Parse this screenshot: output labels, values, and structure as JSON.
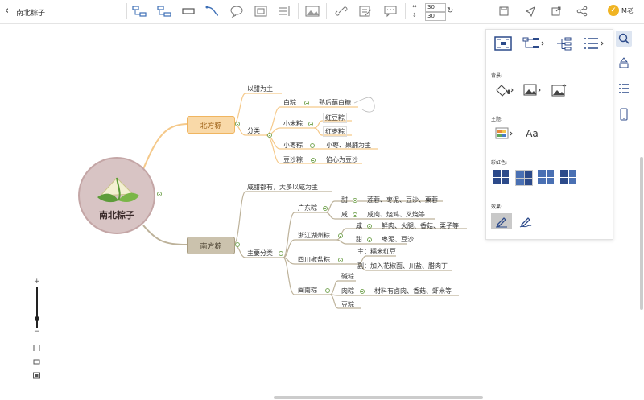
{
  "header": {
    "back_glyph": "‹",
    "title": "南北粽子",
    "width_value": "30",
    "height_value": "30",
    "user_name": "M老",
    "avatar_glyph": "✓"
  },
  "toolbar_icons": [
    "structure-icon",
    "subtopic-icon",
    "topic-box-icon",
    "connector-icon",
    "comment-icon",
    "summary-icon",
    "outline-icon",
    "image-icon",
    "link-icon",
    "note-icon",
    "message-icon"
  ],
  "mindmap": {
    "root": "南北粽子",
    "north": {
      "label": "北方粽",
      "b1": "以甜为主",
      "b2": "分类",
      "items": {
        "baizong": "白粽",
        "baizong_detail": "熟后蘸白糖",
        "xiaomi": "小米粽",
        "hongdou": "红豆粽",
        "hongzao": "红枣粽",
        "xiaozao": "小枣粽",
        "xiaozao_detail": "小枣、果脯为主",
        "dousha": "豆沙粽",
        "dousha_detail": "馅心为豆沙"
      }
    },
    "south": {
      "label": "南方粽",
      "b1": "咸甜都有，大多以咸为主",
      "b2": "主要分类",
      "guangdong": "广东粽",
      "gd_sweet": "甜",
      "gd_sweet_detail": "莲蓉、枣泥、豆沙、栗蓉",
      "gd_salty": "咸",
      "gd_salty_detail": "咸肉、烧鸡、叉烧等",
      "jiangzhe": "浙江湖州粽",
      "jz_salty": "咸",
      "jz_salty_detail": "鲜肉、火腿、香菇、栗子等",
      "jz_sweet": "甜",
      "jz_sweet_detail": "枣泥、豆沙",
      "sichuan": "四川椒盐粽",
      "sc_main": "主：糯米红豆",
      "sc_sub": "副：加入花椒面、川盐、腊肉丁",
      "minnan": "闽南粽",
      "mn_jian": "碱粽",
      "mn_rou": "肉粽",
      "mn_rou_detail": "材料有卤肉、香菇、虾米等",
      "mn_dou": "豆粽"
    }
  },
  "panel": {
    "background_label": "背景:",
    "theme_label": "主题:",
    "color_label": "彩虹色:",
    "effect_label": "效果:",
    "font_glyph": "Aa"
  },
  "zoom": {
    "plus": "+",
    "minus": "−"
  },
  "colors": {
    "north_branch": "#f5c98a",
    "north_fill": "#f9d9a8",
    "south_branch": "#bdb29a",
    "south_fill": "#cbc2ad",
    "accent_blue": "#2c4a8a"
  }
}
